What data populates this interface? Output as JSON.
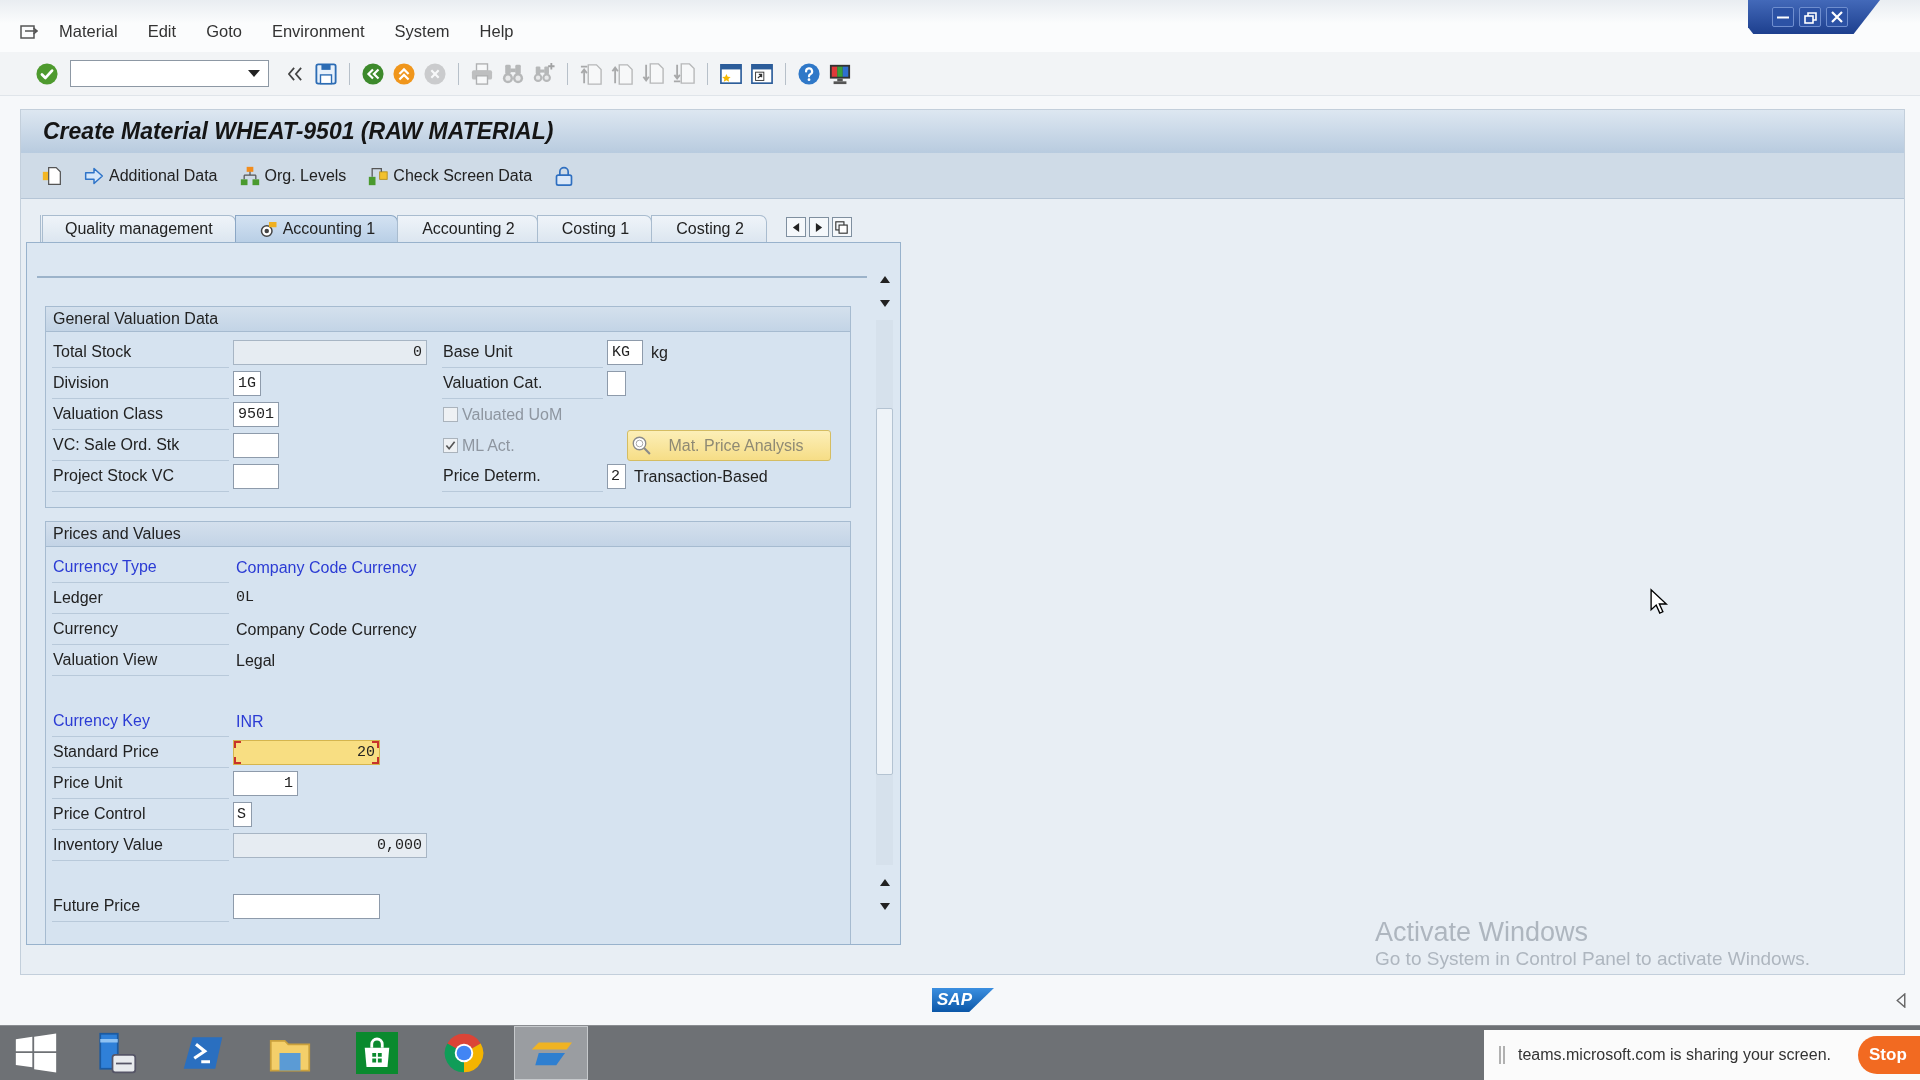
{
  "window": {
    "title": "Create Material WHEAT-9501 (RAW MATERIAL)"
  },
  "menu_bar": [
    {
      "label": "Material"
    },
    {
      "label": "Edit"
    },
    {
      "label": "Goto"
    },
    {
      "label": "Environment"
    },
    {
      "label": "System"
    },
    {
      "label": "Help"
    }
  ],
  "toolbar": {
    "groups": [
      [
        {
          "kind": "enter",
          "disabled": false
        },
        {
          "kind": "command",
          "disabled": false
        },
        {
          "kind": "collapse",
          "disabled": false
        },
        {
          "kind": "save",
          "disabled": false
        }
      ],
      [
        {
          "kind": "back",
          "disabled": false
        },
        {
          "kind": "exit",
          "disabled": false
        },
        {
          "kind": "cancel",
          "disabled": true
        }
      ],
      [
        {
          "kind": "print",
          "disabled": true
        },
        {
          "kind": "find",
          "disabled": true
        },
        {
          "kind": "findnext",
          "disabled": true
        }
      ],
      [
        {
          "kind": "firstpage",
          "disabled": true
        },
        {
          "kind": "prevpage",
          "disabled": true
        },
        {
          "kind": "nextpage",
          "disabled": true
        },
        {
          "kind": "lastpage",
          "disabled": true
        }
      ],
      [
        {
          "kind": "newsession",
          "disabled": false
        },
        {
          "kind": "shortcut",
          "disabled": false
        }
      ],
      [
        {
          "kind": "help",
          "disabled": false
        },
        {
          "kind": "layout",
          "disabled": false
        }
      ]
    ]
  },
  "app_toolbar": [
    {
      "kind": "views"
    },
    {
      "kind": "additional",
      "label": "Additional Data"
    },
    {
      "kind": "orglevels",
      "label": "Org. Levels"
    },
    {
      "kind": "check",
      "label": "Check Screen Data"
    },
    {
      "kind": "lock"
    }
  ],
  "tabs": [
    {
      "label": "Quality management",
      "selected": false
    },
    {
      "label": "Accounting 1",
      "selected": true
    },
    {
      "label": "Accounting 2",
      "selected": false
    },
    {
      "label": "Costing 1",
      "selected": false
    },
    {
      "label": "Costing 2",
      "selected": false
    }
  ],
  "sections": [
    {
      "title": "General Valuation Data",
      "columns": [
        [
          {
            "kind": "output",
            "label": "Total Stock",
            "value": "0"
          },
          {
            "kind": "input",
            "label": "Division",
            "value": "1G",
            "focused": false
          },
          {
            "kind": "input",
            "label": "Valuation Class",
            "value": "9501",
            "focused": false
          },
          {
            "kind": "input",
            "label": "VC: Sale Ord. Stk",
            "focused": false
          },
          {
            "kind": "input",
            "label": "Project Stock VC",
            "focused": false
          }
        ],
        [
          {
            "kind": "input",
            "label": "Base Unit",
            "value": "KG",
            "description": "kg",
            "focused": false
          },
          {
            "kind": "input",
            "label": "Valuation Cat.",
            "focused": false
          },
          {
            "kind": "checkbox",
            "label": "Valuated UoM",
            "checked": false,
            "disabled": true
          },
          {
            "kind": "checkbox",
            "label": "ML Act.",
            "checked": true,
            "disabled": true,
            "button": {
              "label": "Mat. Price Analysis",
              "disabled": true
            }
          },
          {
            "kind": "input",
            "label": "Price Determ.",
            "value": "2",
            "description": "Transaction-Based",
            "focused": false
          }
        ]
      ]
    },
    {
      "title": "Prices and Values",
      "groups": [
        [
          {
            "kind": "key",
            "label": "Currency Type",
            "value": "Company Code Currency"
          },
          {
            "kind": "code",
            "label": "Ledger",
            "value": "0L"
          },
          {
            "kind": "text",
            "label": "Currency",
            "value": "Company Code Currency"
          },
          {
            "kind": "text",
            "label": "Valuation View",
            "value": "Legal"
          }
        ],
        [
          {
            "kind": "key",
            "label": "Currency Key",
            "value": "INR"
          },
          {
            "kind": "input",
            "label": "Standard Price",
            "value": "20",
            "focused": true
          },
          {
            "kind": "input",
            "label": "Price Unit",
            "value": "1",
            "focused": false
          },
          {
            "kind": "input",
            "label": "Price Control",
            "value": "S",
            "focused": false
          },
          {
            "kind": "output",
            "label": "Inventory Value",
            "value": "0,000"
          }
        ],
        [
          {
            "kind": "input",
            "label": "Future Price",
            "focused": false
          }
        ]
      ]
    }
  ],
  "activation_notice": {
    "title": "Activate Windows",
    "text": "Go to System in Control Panel to activate Windows."
  },
  "status_bar": {
    "logo": "SAP"
  },
  "taskbar": {
    "apps": [
      {
        "kind": "server",
        "selected": false
      },
      {
        "kind": "terminal",
        "selected": false
      },
      {
        "kind": "folder",
        "selected": false
      },
      {
        "kind": "store",
        "selected": false
      },
      {
        "kind": "browser",
        "selected": false
      },
      {
        "kind": "sapgui",
        "selected": true
      }
    ]
  },
  "screen_share": {
    "message": "teams.microsoft.com is sharing your screen.",
    "button": "Stop"
  }
}
